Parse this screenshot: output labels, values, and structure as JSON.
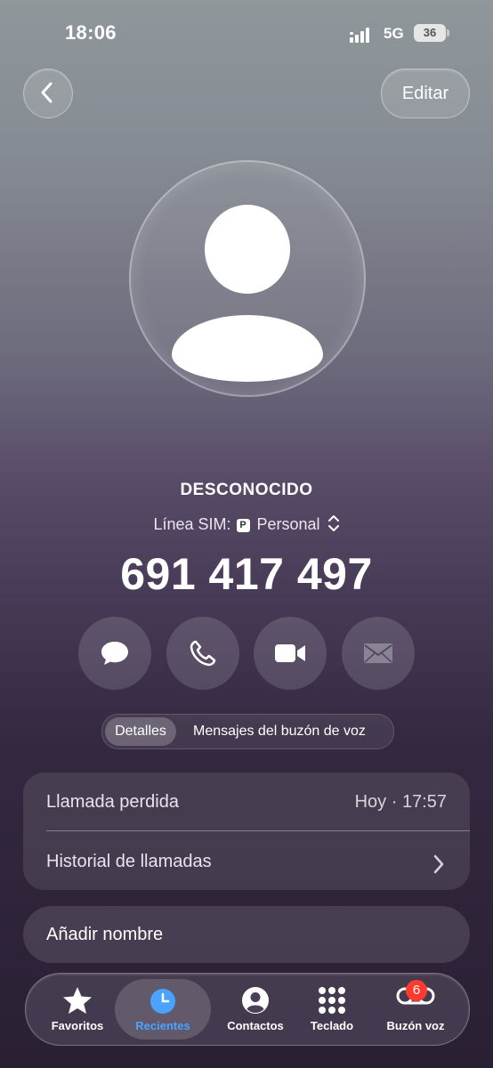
{
  "status_bar": {
    "time": "18:06",
    "network": "5G",
    "battery": "36"
  },
  "header": {
    "edit_label": "Editar"
  },
  "contact": {
    "name": "DESCONOCIDO",
    "sim_label": "Línea SIM:",
    "sim_badge": "P",
    "sim_line": "Personal",
    "number": "691 417 497"
  },
  "actions": [
    {
      "icon": "message-icon"
    },
    {
      "icon": "phone-icon"
    },
    {
      "icon": "video-icon"
    },
    {
      "icon": "mail-icon"
    }
  ],
  "segmented": {
    "active": "Detalles",
    "other": "Mensajes del buzón de voz"
  },
  "details": {
    "missed_call_label": "Llamada perdida",
    "missed_call_day": "Hoy",
    "missed_call_time": "17:57",
    "history_label": "Historial de llamadas"
  },
  "add_name_label": "Añadir nombre",
  "tabbar": {
    "items": [
      {
        "label": "Favoritos",
        "icon": "star-icon"
      },
      {
        "label": "Recientes",
        "icon": "clock-icon",
        "active": true
      },
      {
        "label": "Contactos",
        "icon": "person-circle-icon"
      },
      {
        "label": "Teclado",
        "icon": "keypad-icon"
      },
      {
        "label": "Buzón voz",
        "icon": "voicemail-icon"
      }
    ],
    "voicemail_badge": "6"
  },
  "colors": {
    "accent": "#4aa3ff",
    "badge": "#ff3b30"
  }
}
